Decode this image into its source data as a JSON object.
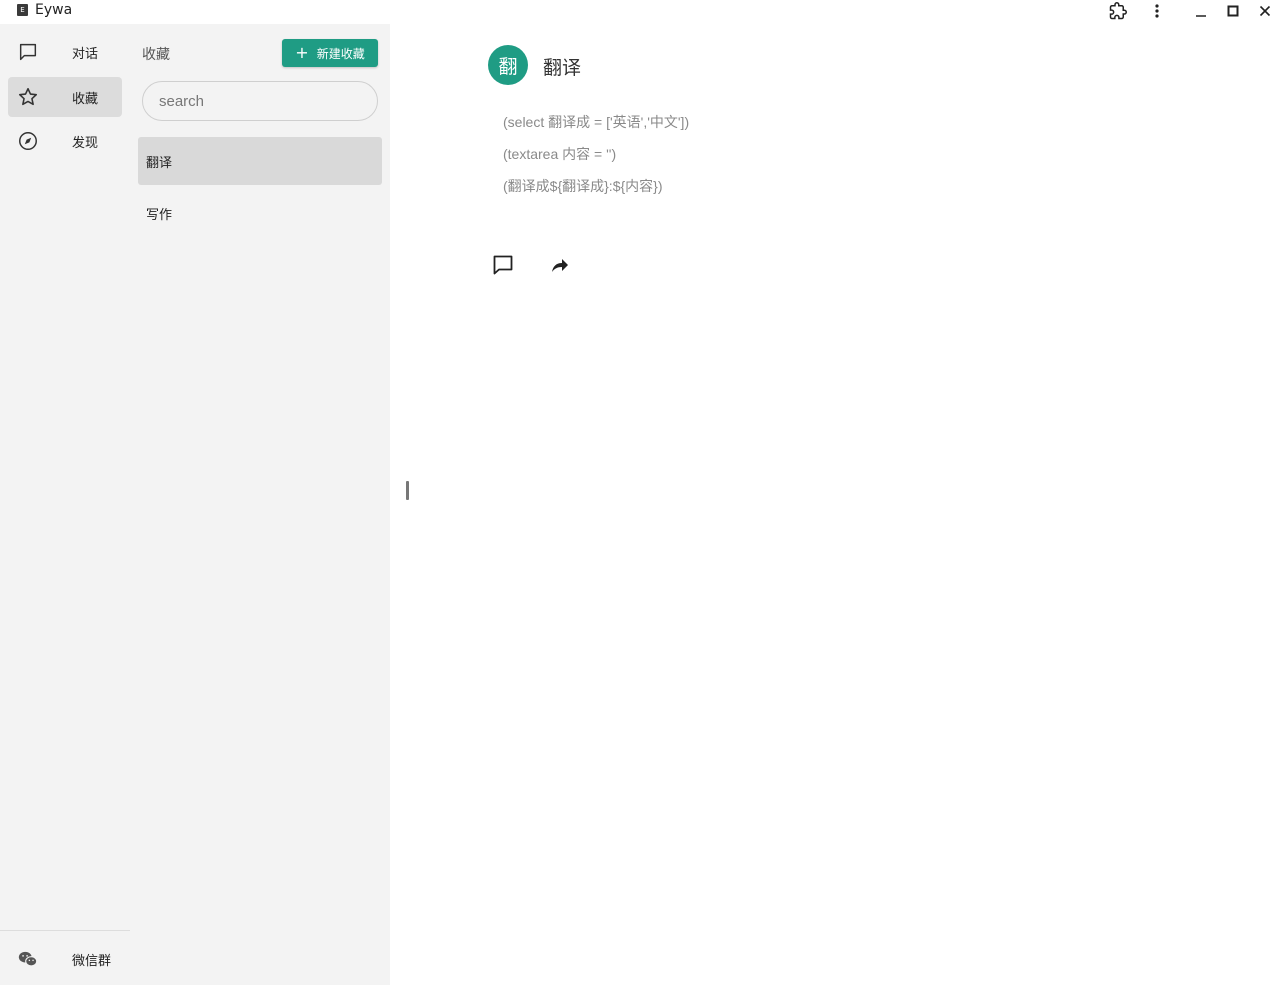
{
  "window": {
    "app_icon_text": "E",
    "title": "Eywa"
  },
  "rail": {
    "items": [
      {
        "label": "对话",
        "icon": "chat-bubble-icon"
      },
      {
        "label": "收藏",
        "icon": "star-icon",
        "active": true
      },
      {
        "label": "发现",
        "icon": "compass-icon"
      }
    ],
    "bottom": {
      "label": "微信群",
      "icon": "wechat-icon"
    }
  },
  "favorites": {
    "title": "收藏",
    "new_button_label": "新建收藏",
    "search_placeholder": "search",
    "items": [
      {
        "label": "翻译",
        "selected": true
      },
      {
        "label": "写作"
      }
    ]
  },
  "detail": {
    "avatar_text": "翻",
    "title": "翻译",
    "prompt_lines": [
      "(select 翻译成 = ['英语','中文'])",
      "(textarea 内容 = '')",
      "(翻译成${翻译成}:${内容})"
    ],
    "actions": [
      "chat-icon",
      "share-icon"
    ]
  },
  "colors": {
    "accent": "#1f9c84",
    "sidebar_bg": "#f3f3f3",
    "active_bg": "#dcdcdc"
  }
}
